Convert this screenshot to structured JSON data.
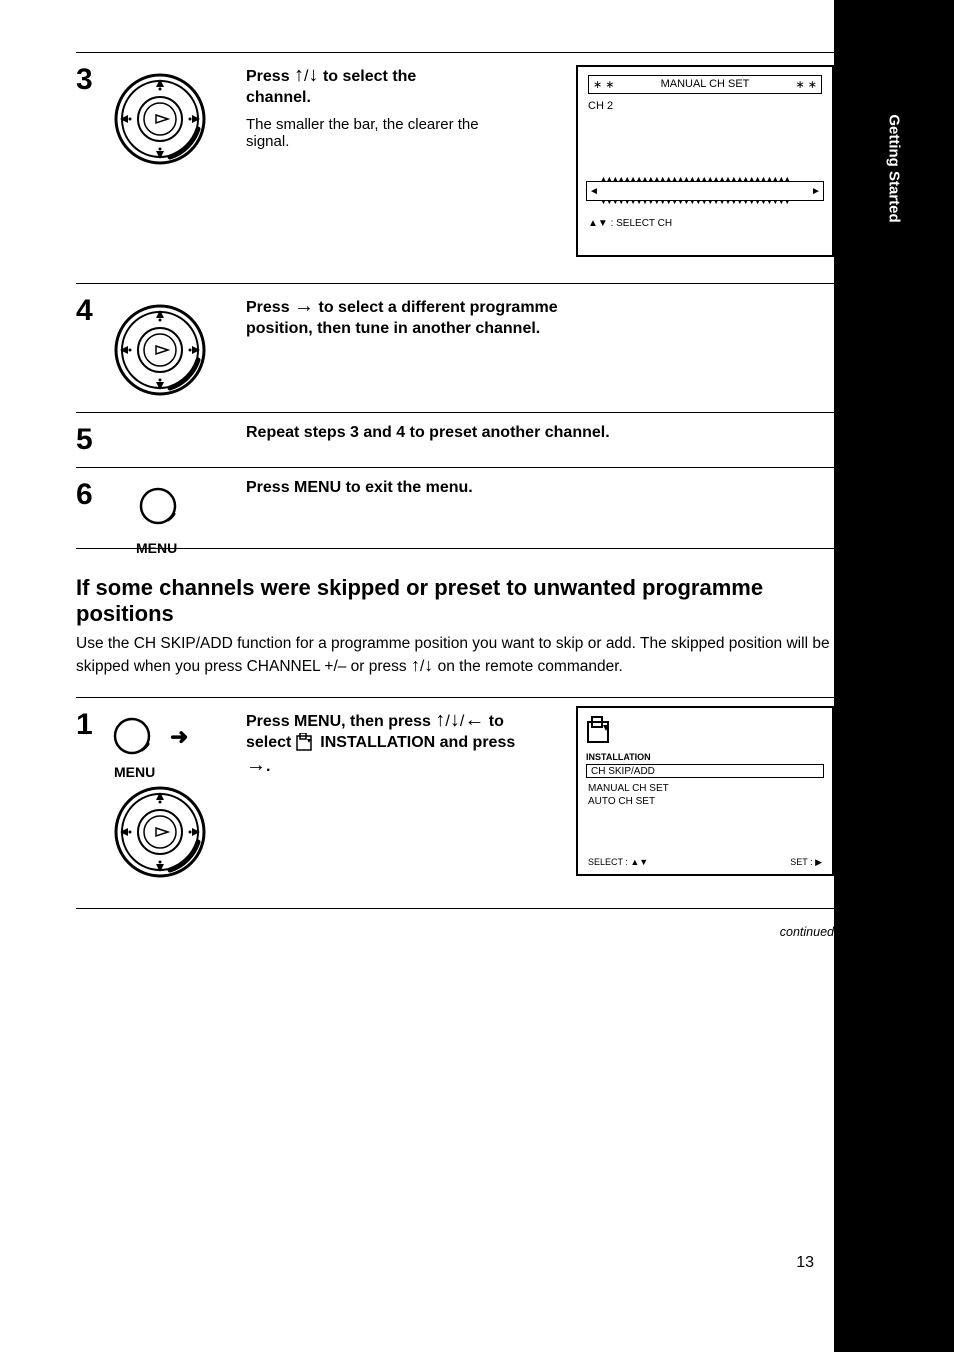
{
  "tab_label": "Getting Started",
  "step3": {
    "num": "3",
    "line1_a": "Press ",
    "line1_b": " to select the",
    "line2": "channel.",
    "note": "The smaller the bar, the clearer the signal.",
    "screen": {
      "stars": "∗ ∗",
      "title": "MANUAL CH SET",
      "stars2": "∗ ∗",
      "label1": "CH     2",
      "foot": "▲▼ : SELECT CH"
    }
  },
  "step4": {
    "num": "4",
    "line1_a": "Press ",
    "line1_b": " to select a different programme",
    "line2": "position, then tune in another channel."
  },
  "step5": {
    "num": "5",
    "line1": "Repeat steps 3 and 4 to preset another channel."
  },
  "step6": {
    "num": "6",
    "line1": "Press MENU to exit the menu.",
    "button": "MENU"
  },
  "section": {
    "title": "If some channels were skipped or preset to unwanted programme positions",
    "para": "Use the CH SKIP/ADD function for a programme position you want to skip or add. The skipped position will be skipped when you press CHANNEL +/– or press ",
    "arrows": " on the remote commander."
  },
  "step1": {
    "num": "1",
    "line1_a": "Press MENU, then press ",
    "line1_b": " to",
    "line2_a": "select ",
    "line2_b": " INSTALLATION and press",
    "line3": ".",
    "button": "MENU",
    "screen": {
      "install": "INSTALLATION",
      "hl": "CH SKIP/ADD",
      "row2": "MANUAL CH SET",
      "row3": "AUTO CH SET",
      "foot_left": "SELECT : ▲▼",
      "foot_right": "SET : ▶"
    }
  },
  "continued": "continued",
  "pagenum": "13"
}
